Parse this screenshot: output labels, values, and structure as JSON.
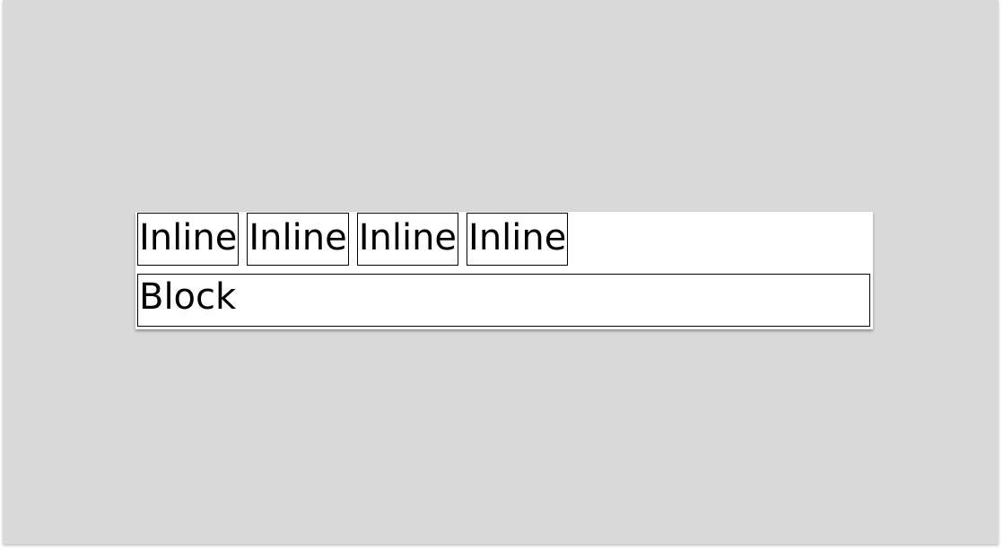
{
  "inline_boxes": [
    {
      "label": "Inline"
    },
    {
      "label": "Inline"
    },
    {
      "label": "Inline"
    },
    {
      "label": "Inline"
    }
  ],
  "block_box": {
    "label": "Block"
  }
}
